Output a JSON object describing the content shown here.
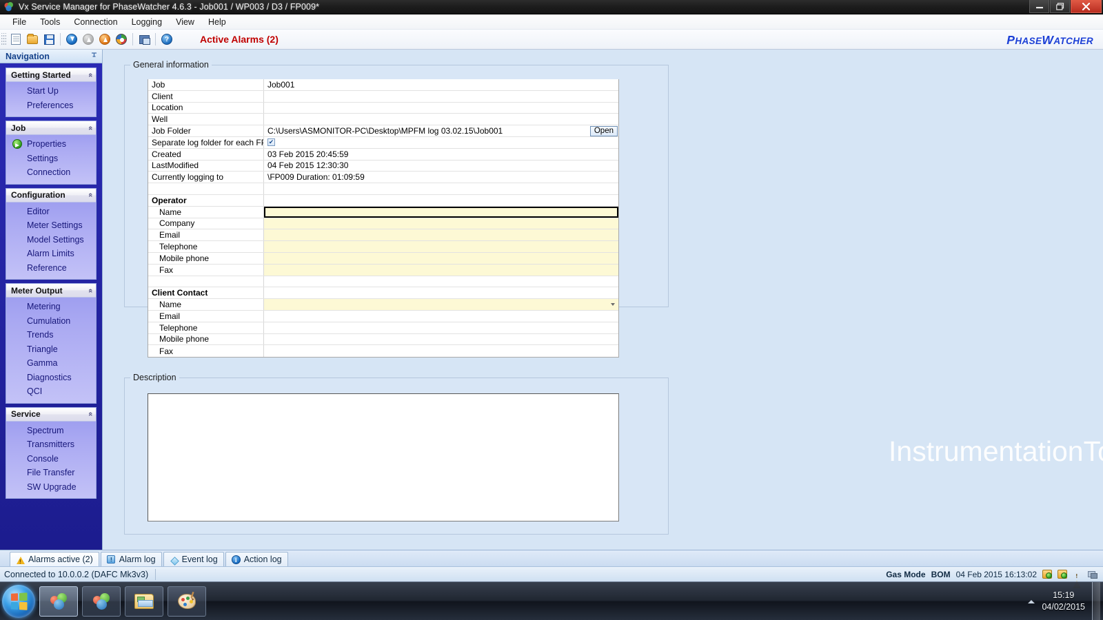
{
  "window": {
    "title": "Vx Service Manager for PhaseWatcher 4.6.3 - Job001 / WP003 / D3 / FP009*",
    "minimize_label": "–",
    "maximize_label": "❐",
    "close_label": "✕"
  },
  "menubar": {
    "items": [
      {
        "label": "File"
      },
      {
        "label": "Tools"
      },
      {
        "label": "Connection"
      },
      {
        "label": "Logging"
      },
      {
        "label": "View"
      },
      {
        "label": "Help"
      }
    ]
  },
  "toolbar": {
    "buttons": [
      {
        "name": "new-job-icon"
      },
      {
        "name": "open-job-icon"
      },
      {
        "name": "save-job-icon"
      },
      {
        "name": "download-icon"
      },
      {
        "name": "upload-disabled-icon"
      },
      {
        "name": "upload-icon"
      },
      {
        "name": "refresh-icon"
      },
      {
        "name": "window-icon"
      },
      {
        "name": "help-icon"
      }
    ],
    "active_alarms": "Active Alarms (2)",
    "brand_main": "P",
    "brand": "HASE",
    "brand_w": "W",
    "brand_tail": "ATCHER"
  },
  "navigation": {
    "header": "Navigation",
    "pin_glyph": "⎯",
    "collapse_glyph": "«",
    "groups": [
      {
        "title": "Getting Started",
        "items": [
          {
            "label": "Start Up",
            "icon": false
          },
          {
            "label": "Preferences",
            "icon": false
          }
        ]
      },
      {
        "title": "Job",
        "items": [
          {
            "label": "Properties",
            "icon": true
          },
          {
            "label": "Settings",
            "icon": false
          },
          {
            "label": "Connection",
            "icon": false
          }
        ]
      },
      {
        "title": "Configuration",
        "items": [
          {
            "label": "Editor",
            "icon": false
          },
          {
            "label": "Meter Settings",
            "icon": false
          },
          {
            "label": "Model Settings",
            "icon": false
          },
          {
            "label": "Alarm Limits",
            "icon": false
          },
          {
            "label": "Reference",
            "icon": false
          }
        ]
      },
      {
        "title": "Meter Output",
        "items": [
          {
            "label": "Metering",
            "icon": false
          },
          {
            "label": "Cumulation",
            "icon": false
          },
          {
            "label": "Trends",
            "icon": false
          },
          {
            "label": "Triangle",
            "icon": false
          },
          {
            "label": "Gamma",
            "icon": false
          },
          {
            "label": "Diagnostics",
            "icon": false
          },
          {
            "label": "QCI",
            "icon": false
          }
        ]
      },
      {
        "title": "Service",
        "items": [
          {
            "label": "Spectrum",
            "icon": false
          },
          {
            "label": "Transmitters",
            "icon": false
          },
          {
            "label": "Console",
            "icon": false
          },
          {
            "label": "File Transfer",
            "icon": false
          },
          {
            "label": "SW Upgrade",
            "icon": false
          }
        ]
      }
    ]
  },
  "general_information": {
    "title": "General information",
    "open_button": "Open",
    "rows": [
      {
        "label": "Job",
        "value": "Job001",
        "style": "plain",
        "indent": false
      },
      {
        "label": "Client",
        "value": "",
        "style": "plain",
        "indent": false
      },
      {
        "label": "Location",
        "value": "",
        "style": "plain",
        "indent": false
      },
      {
        "label": "Well",
        "value": "",
        "style": "plain",
        "indent": false
      },
      {
        "label": "Job Folder",
        "value": "C:\\Users\\ASMONITOR-PC\\Desktop\\MPFM log 03.02.15\\Job001",
        "style": "folder",
        "indent": false
      },
      {
        "label": "Separate log folder for each FP",
        "value": "",
        "style": "checkbox",
        "checked": true,
        "indent": false
      },
      {
        "label": "Created",
        "value": "03 Feb 2015 20:45:59",
        "style": "plain",
        "indent": false
      },
      {
        "label": "LastModified",
        "value": "04 Feb 2015 12:30:30",
        "style": "plain",
        "indent": false
      },
      {
        "label": "Currently logging to",
        "value": "\\FP009   Duration: 01:09:59",
        "style": "plain",
        "indent": false
      },
      {
        "label": "",
        "value": "",
        "style": "blank",
        "indent": false
      },
      {
        "label": "Operator",
        "value": "",
        "style": "section",
        "indent": false
      },
      {
        "label": "Name",
        "value": "",
        "style": "selected",
        "indent": true
      },
      {
        "label": "Company",
        "value": "",
        "style": "yellow",
        "indent": true
      },
      {
        "label": "Email",
        "value": "",
        "style": "yellow",
        "indent": true
      },
      {
        "label": "Telephone",
        "value": "",
        "style": "yellow",
        "indent": true
      },
      {
        "label": "Mobile phone",
        "value": "",
        "style": "yellow",
        "indent": true
      },
      {
        "label": "Fax",
        "value": "",
        "style": "yellow",
        "indent": true
      },
      {
        "label": "",
        "value": "",
        "style": "blank",
        "indent": false
      },
      {
        "label": "Client Contact",
        "value": "",
        "style": "section",
        "indent": false
      },
      {
        "label": "Name",
        "value": "",
        "style": "dropdown",
        "indent": true
      },
      {
        "label": "Email",
        "value": "",
        "style": "plain",
        "indent": true
      },
      {
        "label": "Telephone",
        "value": "",
        "style": "plain",
        "indent": true
      },
      {
        "label": "Mobile phone",
        "value": "",
        "style": "plain",
        "indent": true
      },
      {
        "label": "Fax",
        "value": "",
        "style": "plain",
        "indent": true
      }
    ]
  },
  "description": {
    "title": "Description",
    "value": "",
    "placeholder": ""
  },
  "watermark": "InstrumentationTools.com",
  "bottom_tabs": [
    {
      "label": "Alarms active (2)",
      "icon": "warning-icon",
      "selected": true
    },
    {
      "label": "Alarm log",
      "icon": "alarm-log-icon",
      "selected": false
    },
    {
      "label": "Event log",
      "icon": "event-log-icon",
      "selected": false
    },
    {
      "label": "Action log",
      "icon": "info-icon",
      "selected": false
    }
  ],
  "statusbar": {
    "connection": "Connected to 10.0.0.2 (DAFC Mk3v3)",
    "gas_mode_label": "Gas Mode",
    "gas_mode_value": "BOM",
    "timestamp": "04 Feb 2015 16:13:02",
    "tray_icons": [
      "sync-yellow-icon",
      "sync-yellow-icon",
      "warning-icon",
      "network-icon"
    ]
  },
  "taskbar": {
    "start_label": "Start",
    "tasks": [
      {
        "name": "taskbar-vx-service-manager",
        "icon": "bubbles-icon",
        "active": true
      },
      {
        "name": "taskbar-vx-second-window",
        "icon": "bubbles-icon",
        "active": false
      },
      {
        "name": "taskbar-windows-explorer",
        "icon": "explorer-icon",
        "active": false
      },
      {
        "name": "taskbar-paint",
        "icon": "paint-icon",
        "active": false
      }
    ],
    "clock_time": "15:19",
    "clock_date": "04/02/2015"
  },
  "colors": {
    "accent_blue": "#1b3fd6",
    "alarm_red": "#c00000",
    "nav_blue": "#1c1c8e",
    "field_yellow": "#fdf9d5",
    "workarea_blue": "#d6e5f5"
  }
}
